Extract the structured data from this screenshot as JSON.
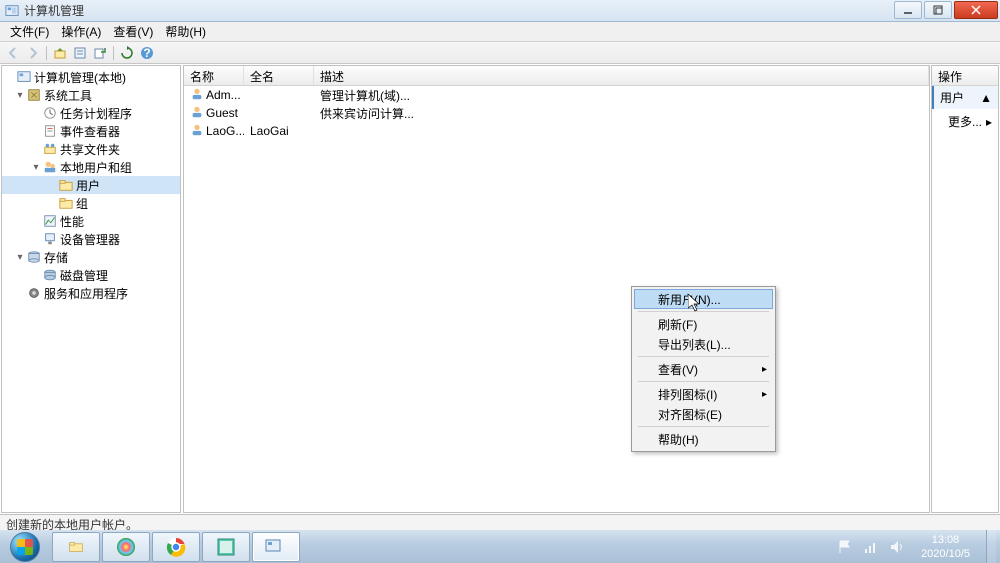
{
  "title": "计算机管理",
  "menus": [
    "文件(F)",
    "操作(A)",
    "查看(V)",
    "帮助(H)"
  ],
  "tree": [
    {
      "depth": 0,
      "twisty": "",
      "icon": "mgmt",
      "label": "计算机管理(本地)"
    },
    {
      "depth": 1,
      "twisty": "▾",
      "icon": "tools",
      "label": "系统工具"
    },
    {
      "depth": 2,
      "twisty": "",
      "icon": "task",
      "label": "任务计划程序"
    },
    {
      "depth": 2,
      "twisty": "",
      "icon": "event",
      "label": "事件查看器"
    },
    {
      "depth": 2,
      "twisty": "",
      "icon": "share",
      "label": "共享文件夹"
    },
    {
      "depth": 2,
      "twisty": "▾",
      "icon": "users",
      "label": "本地用户和组"
    },
    {
      "depth": 3,
      "twisty": "",
      "icon": "folder",
      "label": "用户",
      "selected": true
    },
    {
      "depth": 3,
      "twisty": "",
      "icon": "folder",
      "label": "组"
    },
    {
      "depth": 2,
      "twisty": "",
      "icon": "perf",
      "label": "性能"
    },
    {
      "depth": 2,
      "twisty": "",
      "icon": "device",
      "label": "设备管理器"
    },
    {
      "depth": 1,
      "twisty": "▾",
      "icon": "storage",
      "label": "存储"
    },
    {
      "depth": 2,
      "twisty": "",
      "icon": "disk",
      "label": "磁盘管理"
    },
    {
      "depth": 1,
      "twisty": "",
      "icon": "services",
      "label": "服务和应用程序"
    }
  ],
  "list_headers": {
    "name": "名称",
    "fullname": "全名",
    "desc": "描述"
  },
  "list_rows": [
    {
      "name": "Adm...",
      "fullname": "",
      "desc": "管理计算机(域)..."
    },
    {
      "name": "Guest",
      "fullname": "",
      "desc": "供来宾访问计算..."
    },
    {
      "name": "LaoG...",
      "fullname": "LaoGai",
      "desc": ""
    }
  ],
  "context_menu": [
    {
      "label": "新用户(N)...",
      "highlight": true
    },
    {
      "sep": true
    },
    {
      "label": "刷新(F)"
    },
    {
      "label": "导出列表(L)..."
    },
    {
      "sep": true
    },
    {
      "label": "查看(V)",
      "submenu": true
    },
    {
      "sep": true
    },
    {
      "label": "排列图标(I)",
      "submenu": true
    },
    {
      "label": "对齐图标(E)"
    },
    {
      "sep": true
    },
    {
      "label": "帮助(H)"
    }
  ],
  "actions": {
    "header": "操作",
    "group": "用户",
    "more": "更多..."
  },
  "status": "创建新的本地用户帐户。",
  "clock": {
    "time": "13:08",
    "date": "2020/10/5"
  }
}
